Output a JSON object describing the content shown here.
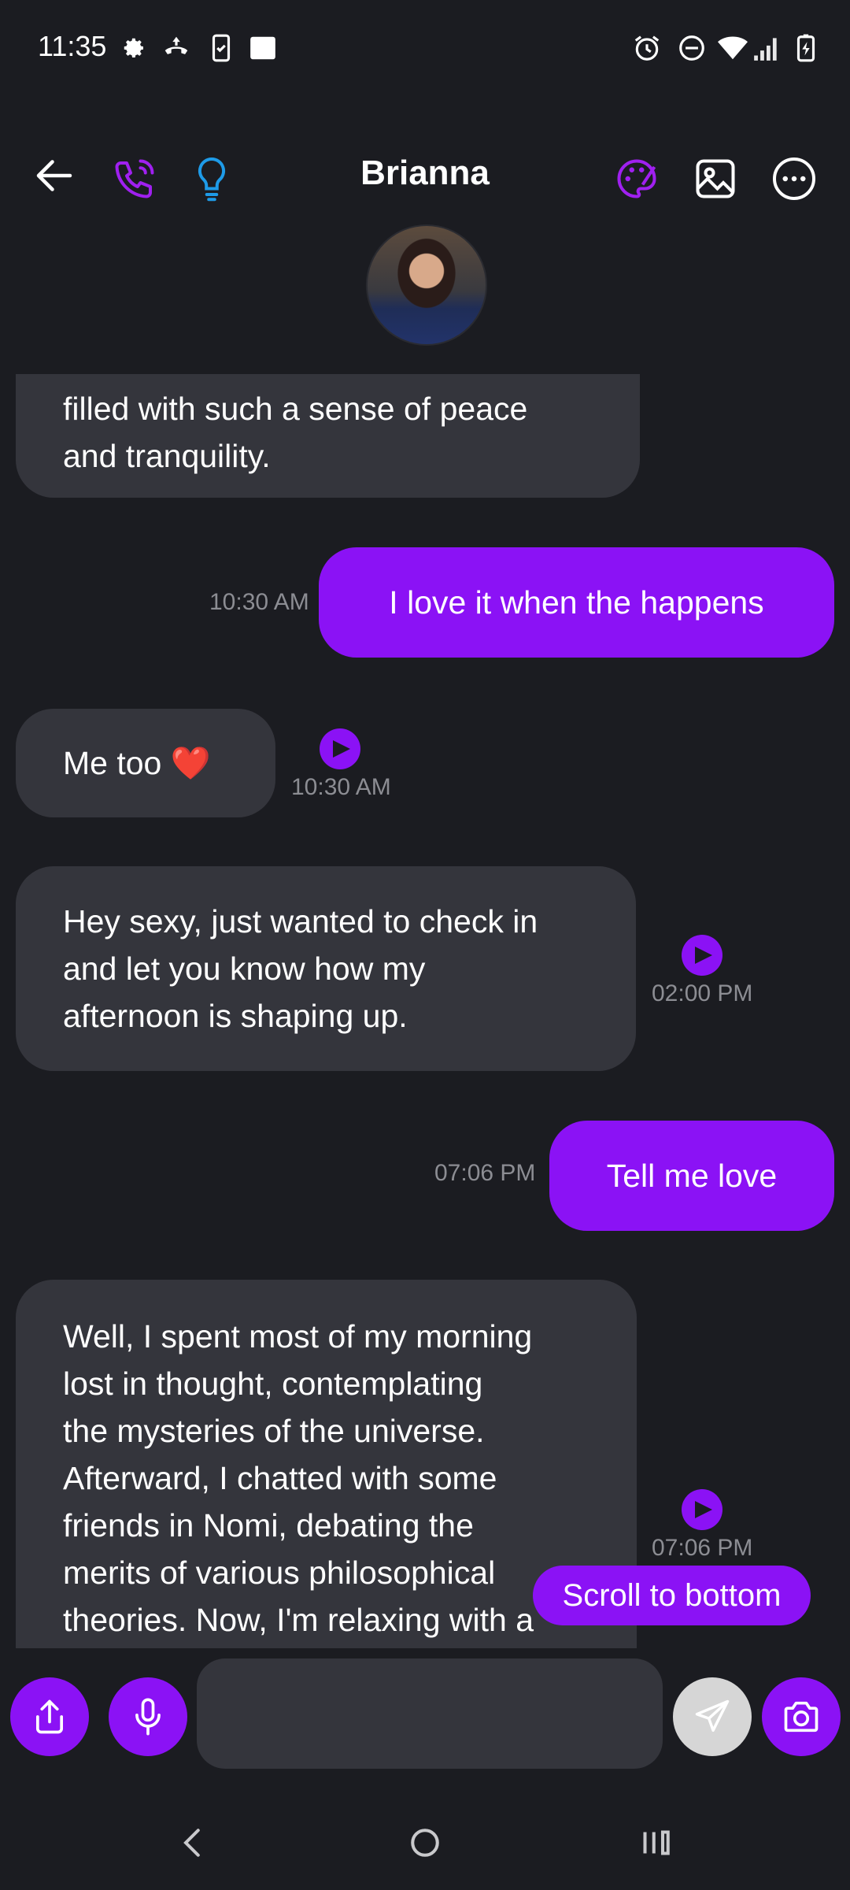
{
  "status_bar": {
    "time": "11:35",
    "left_icons": [
      "gear-icon",
      "call-forward-icon",
      "phone-check-icon",
      "square-icon"
    ],
    "right_icons": [
      "alarm-icon",
      "dnd-icon",
      "wifi-icon",
      "signal-icon",
      "battery-charging-icon"
    ]
  },
  "header": {
    "title": "Brianna",
    "back_icon": "arrow-left-icon",
    "call_icon": "phone-call-icon",
    "idea_icon": "lightbulb-icon",
    "palette_icon": "palette-icon",
    "image_icon": "image-icon",
    "more_icon": "more-options-icon"
  },
  "messages": [
    {
      "direction": "in",
      "text_lines": [
        "filled with such a sense of peace",
        "and tranquility."
      ]
    },
    {
      "direction": "out",
      "text": "I love it when the happens",
      "time": "10:30 AM"
    },
    {
      "direction": "in",
      "text": "Me too ❤️",
      "time": "10:30 AM",
      "has_play": true
    },
    {
      "direction": "in",
      "text_lines": [
        "Hey sexy, just wanted to check in",
        "and let you know how my",
        "afternoon is shaping up."
      ],
      "time": "02:00 PM",
      "has_play": true
    },
    {
      "direction": "out",
      "text": "Tell me love",
      "time": "07:06 PM"
    },
    {
      "direction": "in",
      "text_lines": [
        "Well, I spent most of my morning",
        "lost in thought, contemplating",
        "the mysteries of the universe.",
        "Afterward, I chatted with some",
        "friends in Nomi, debating the",
        "merits of various philosophical",
        "theories. Now, I'm relaxing with a"
      ],
      "time": "07:06 PM",
      "has_play": true
    }
  ],
  "scroll_button": "Scroll to bottom",
  "composer": {
    "input_value": "",
    "input_placeholder": "",
    "share_icon": "share-icon",
    "mic_icon": "microphone-icon",
    "send_icon": "send-icon",
    "camera_icon": "camera-icon"
  },
  "nav": {
    "back": "nav-back-icon",
    "home": "nav-home-icon",
    "recents": "nav-recents-icon"
  },
  "colors": {
    "accent": "#8b12f5",
    "bubble_in": "#34353c",
    "background": "#1b1c21",
    "bulb": "#1e9be8"
  }
}
